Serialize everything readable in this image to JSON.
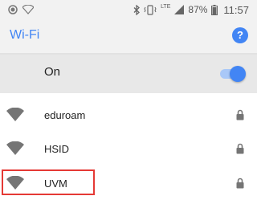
{
  "status_bar": {
    "battery": "87%",
    "time": "11:57",
    "signal_label": "LTE",
    "icons": [
      "record-icon",
      "wifi-status-icon",
      "bluetooth-icon",
      "vibrate-icon",
      "signal-icon",
      "battery-icon"
    ]
  },
  "app_bar": {
    "title": "Wi-Fi",
    "help_label": "?"
  },
  "master_toggle": {
    "label": "On",
    "state": "on"
  },
  "networks": [
    {
      "ssid": "eduroam",
      "secured": true
    },
    {
      "ssid": "HSID",
      "secured": true
    },
    {
      "ssid": "UVM",
      "secured": true,
      "highlighted": true
    }
  ],
  "colors": {
    "accent": "#4285f4",
    "highlight_box": "#e53935",
    "icon_gray": "#757575"
  }
}
